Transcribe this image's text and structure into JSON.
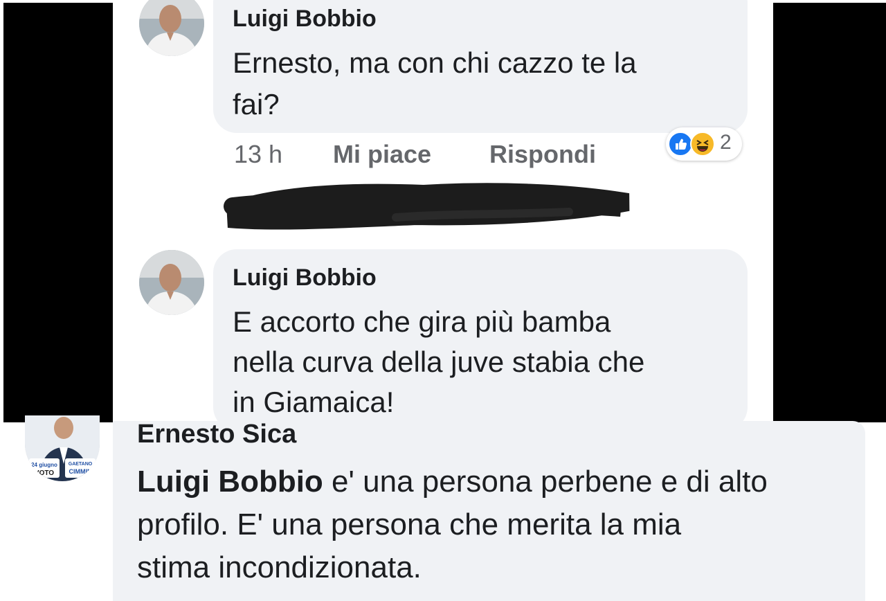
{
  "comments": [
    {
      "author": "Luigi Bobbio",
      "line1": "Ernesto, ma con chi cazzo te la",
      "line2": "fai?",
      "time": "13 h",
      "like_label": "Mi piace",
      "reply_label": "Rispondi",
      "reaction_count": "2",
      "reactions": [
        "like-icon",
        "haha-icon"
      ]
    },
    {
      "author": "Luigi Bobbio",
      "line1": "E accorto che gira più bamba",
      "line2": "nella curva della juve stabia che",
      "line3": "in Giamaica!"
    }
  ],
  "reply": {
    "author": "Ernesto Sica",
    "mention": "Luigi Bobbio",
    "line1_rest": " e' una persona perbene e di alto",
    "line2": "profilo. E' una persona che merita la mia",
    "line3": "stima incondizionata.",
    "avatar_text1": "24 giugno",
    "avatar_text2": "VOTO",
    "avatar_text3": "GAETANO",
    "avatar_text4": "CIMMIN"
  },
  "colors": {
    "bubble": "#f0f2f5",
    "text": "#1c1e21",
    "meta": "#65676b",
    "like": "#1877f2",
    "haha": "#f7b928"
  }
}
